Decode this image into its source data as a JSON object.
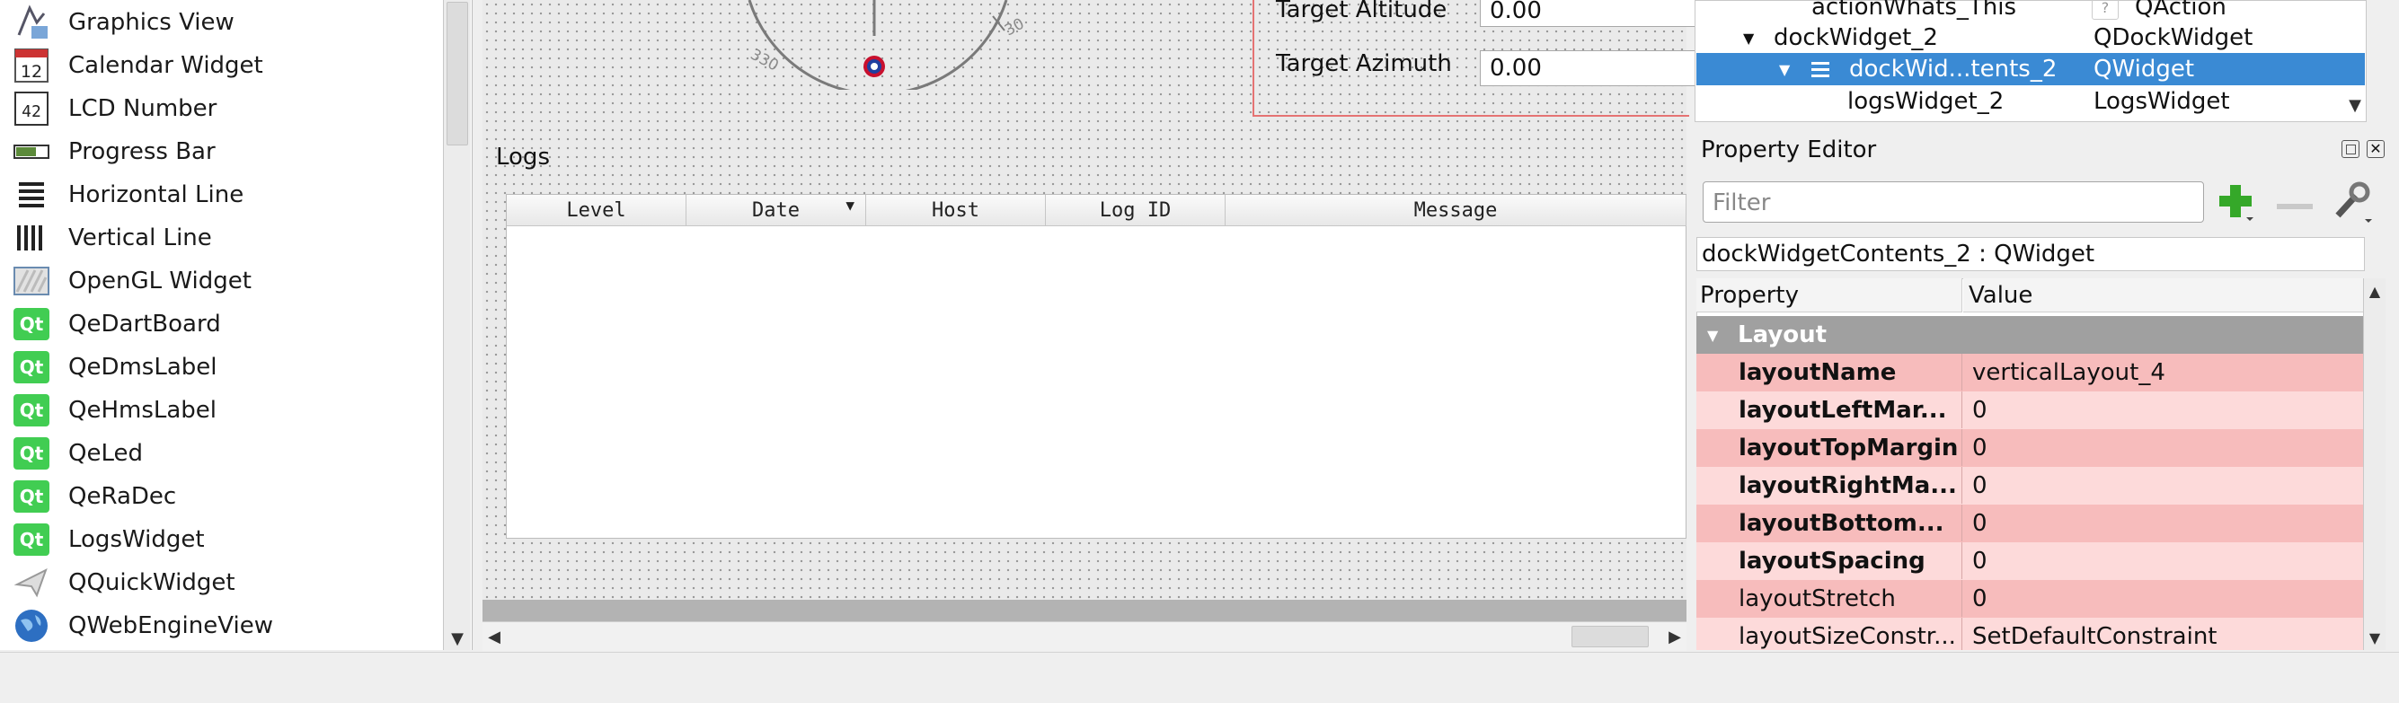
{
  "widget_box": {
    "items": [
      {
        "label": "Graphics View",
        "icon": "graphics-view-icon"
      },
      {
        "label": "Calendar Widget",
        "icon": "calendar-icon",
        "icon_text": "12"
      },
      {
        "label": "LCD Number",
        "icon": "lcd-number-icon",
        "icon_text": "42"
      },
      {
        "label": "Progress Bar",
        "icon": "progress-bar-icon"
      },
      {
        "label": "Horizontal Line",
        "icon": "horizontal-line-icon"
      },
      {
        "label": "Vertical Line",
        "icon": "vertical-line-icon"
      },
      {
        "label": "OpenGL Widget",
        "icon": "opengl-icon"
      },
      {
        "label": "QeDartBoard",
        "icon": "qt-icon",
        "icon_text": "Qt"
      },
      {
        "label": "QeDmsLabel",
        "icon": "qt-icon",
        "icon_text": "Qt"
      },
      {
        "label": "QeHmsLabel",
        "icon": "qt-icon",
        "icon_text": "Qt"
      },
      {
        "label": "QeLed",
        "icon": "qt-icon",
        "icon_text": "Qt"
      },
      {
        "label": "QeRaDec",
        "icon": "qt-icon",
        "icon_text": "Qt"
      },
      {
        "label": "LogsWidget",
        "icon": "qt-icon",
        "icon_text": "Qt"
      },
      {
        "label": "QQuickWidget",
        "icon": "quick-widget-icon"
      },
      {
        "label": "QWebEngineView",
        "icon": "globe-icon"
      }
    ]
  },
  "canvas": {
    "dial_labels": [
      "330",
      "30"
    ],
    "target_altitude_label": "Target Altitude",
    "target_altitude_value": "0.00",
    "target_azimuth_label": "Target Azimuth",
    "target_azimuth_value": "0.00",
    "logs_title": "Logs",
    "logs_columns": [
      "Level",
      "Date",
      "Host",
      "Log ID",
      "Message"
    ]
  },
  "object_inspector": {
    "rows": [
      {
        "name": "actionWhats_This",
        "class": "QAction"
      },
      {
        "name": "dockWidget_2",
        "class": "QDockWidget"
      },
      {
        "name": "dockWid...tents_2",
        "class": "QWidget"
      },
      {
        "name": "logsWidget_2",
        "class": "LogsWidget"
      }
    ]
  },
  "property_editor": {
    "title": "Property Editor",
    "filter_placeholder": "Filter",
    "object_label": "dockWidgetContents_2 : QWidget",
    "col_property": "Property",
    "col_value": "Value",
    "group": "Layout",
    "rows": [
      {
        "name": "layoutName",
        "value": "verticalLayout_4",
        "bold": true
      },
      {
        "name": "layoutLeftMar...",
        "value": "0",
        "bold": true
      },
      {
        "name": "layoutTopMargin",
        "value": "0",
        "bold": true
      },
      {
        "name": "layoutRightMa...",
        "value": "0",
        "bold": true
      },
      {
        "name": "layoutBottom...",
        "value": "0",
        "bold": true
      },
      {
        "name": "layoutSpacing",
        "value": "0",
        "bold": true
      },
      {
        "name": "layoutStretch",
        "value": "0",
        "bold": false
      },
      {
        "name": "layoutSizeConstr...",
        "value": "SetDefaultConstraint",
        "bold": false
      }
    ]
  },
  "colors": {
    "selection": "#3a8ad4",
    "row_dark": "#f7bcbc",
    "row_light": "#fddada",
    "group_header": "#a0a0a0",
    "qt_green": "#41cd52"
  }
}
